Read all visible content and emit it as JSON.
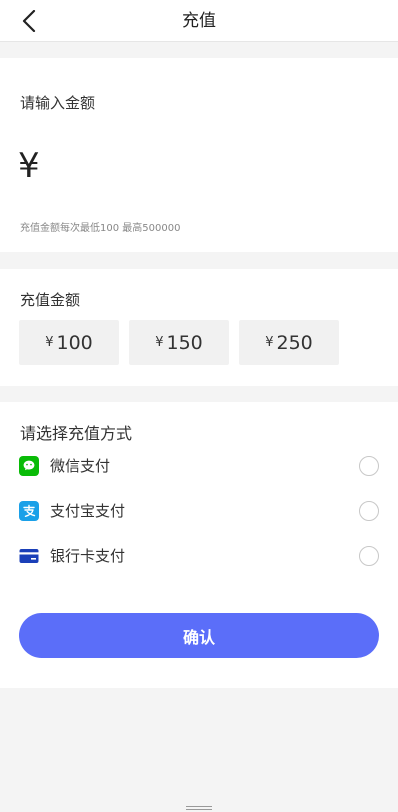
{
  "header": {
    "title": "充值",
    "back_icon": "chevron-left-icon"
  },
  "amount_section": {
    "title": "请输入金额",
    "currency_symbol": "¥",
    "input_value": "",
    "input_placeholder": "",
    "hint": "充值金额每次最低100  最高500000"
  },
  "preset_section": {
    "title": "充值金额",
    "currency_symbol": "¥",
    "amounts": [
      "100",
      "150",
      "250"
    ]
  },
  "payment_section": {
    "title": "请选择充值方式",
    "methods": [
      {
        "label": "微信支付",
        "icon": "wechat-pay-icon",
        "color": "#09bb07",
        "selected": false
      },
      {
        "label": "支付宝支付",
        "icon": "alipay-icon",
        "color": "#1aa0e8",
        "selected": false
      },
      {
        "label": "银行卡支付",
        "icon": "bank-card-icon",
        "color": "#1a3fb8",
        "selected": false
      }
    ],
    "confirm_label": "确认"
  },
  "colors": {
    "accent": "#5b6ef9",
    "page_background": "#f4f4f4"
  }
}
